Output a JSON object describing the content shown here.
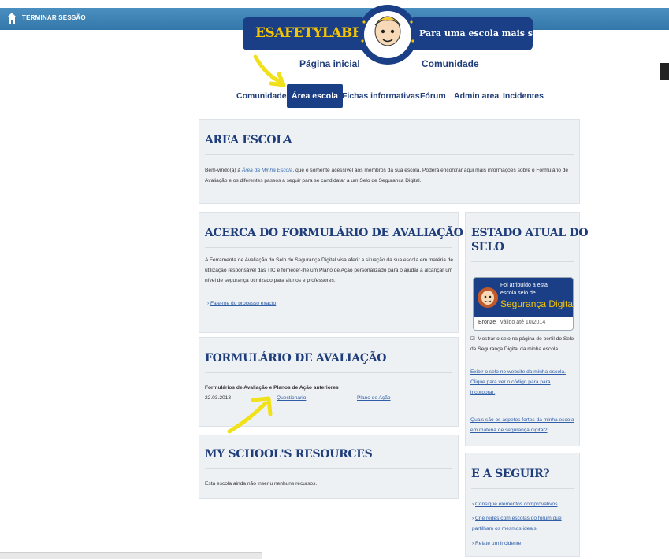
{
  "topbar": {
    "logout": "TERMINAR SESSÃO"
  },
  "banner": {
    "left": "ESAFETYLABEL.EU",
    "right": "Para uma escola mais segura!"
  },
  "nav_primary": [
    "Página inicial",
    "Comunidade"
  ],
  "nav_secondary": [
    "Comunidade",
    "Área escola",
    "Fichas informativas",
    "Fórum",
    "Admin area",
    "Incidentes"
  ],
  "area_escola": {
    "title": "AREA ESCOLA",
    "text_a": "Bem-vindo(a) à ",
    "text_link": "Área da Minha Escola",
    "text_b": ", que é somente acessível aos membros da sua escola. Poderá encontrar aqui mais informações sobre o Formulário de Avaliação e os diferentes passos a seguir para se candidatar a um Selo de Segurança Digital."
  },
  "acerca": {
    "title": "ACERCA DO FORMULÁRIO DE AVALIAÇÃO",
    "text": "A Ferramenta de Avaliação do Selo de Segurança Digital visa aferir a situação da sua escola em matéria de utilização responsável das TIC e fornecer-lhe um Plano de Ação personalizado para o ajudar a alcançar um nível de segurança otimizado para alunos e professores.",
    "link": "Fale-me do processo exacto"
  },
  "formulario": {
    "title": "FORMULÁRIO DE AVALIAÇÃO",
    "subtitle": "Formulários de Avaliação e Planos de Ação anteriores",
    "date": "22.03.2013",
    "link1": "Questionário",
    "link2": "Plano de Ação"
  },
  "resources": {
    "title": "MY SCHOOL'S RESOURCES",
    "text": "Esta escola ainda não inseriu nenhuns recursos."
  },
  "estado": {
    "title_line1": "ESTADO ATUAL DO",
    "title_line2": "SELO",
    "badge_line1": "Foi atribuído a esta",
    "badge_line2": "escola selo de",
    "badge_line3": "Segurança Digital",
    "badge_level": "Bronze",
    "badge_valid": "válido até 10/2014",
    "checkbox_text": "Mostrar o selo na página de perfil do Selo de Segurança Digital da minha escola",
    "link1": "Exibir o selo no website da minha escola.",
    "link2": "Clique para ver o código para para incorporar.",
    "link3": "Quais são os aspetos fortes da minha escola em matéria de segurança digital?"
  },
  "seguir": {
    "title": "E A SEGUIR?",
    "items": [
      "Consigue elementos comprovativos",
      "Crie redes com escolas do fórum que partilham os mesmos ideais",
      "Relate um incidente"
    ]
  },
  "colors": {
    "brand": "#1a3f86",
    "accent": "#f5c400",
    "topbar": "#3f84b8",
    "arrow": "#f0e11a"
  }
}
